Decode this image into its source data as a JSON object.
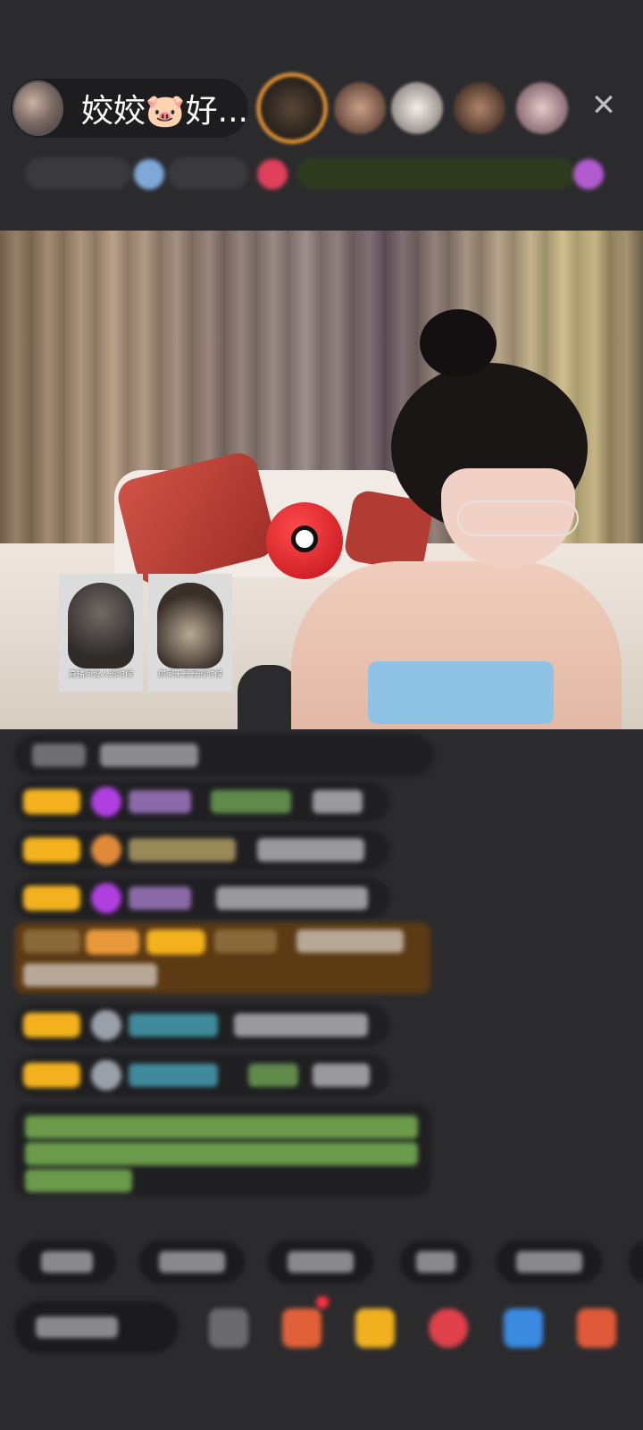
{
  "header": {
    "host_name": "姣姣🐷好...",
    "close_glyph": "✕"
  },
  "video": {
    "meme_captions": [
      "直播间没人的时候",
      "房间来哥哥的时候"
    ]
  },
  "colors": {
    "background": "#2b2b2e",
    "badge_gold": "#f3b21d",
    "gift_highlight": "#5b3a14",
    "host_ring": "#d48b31"
  }
}
